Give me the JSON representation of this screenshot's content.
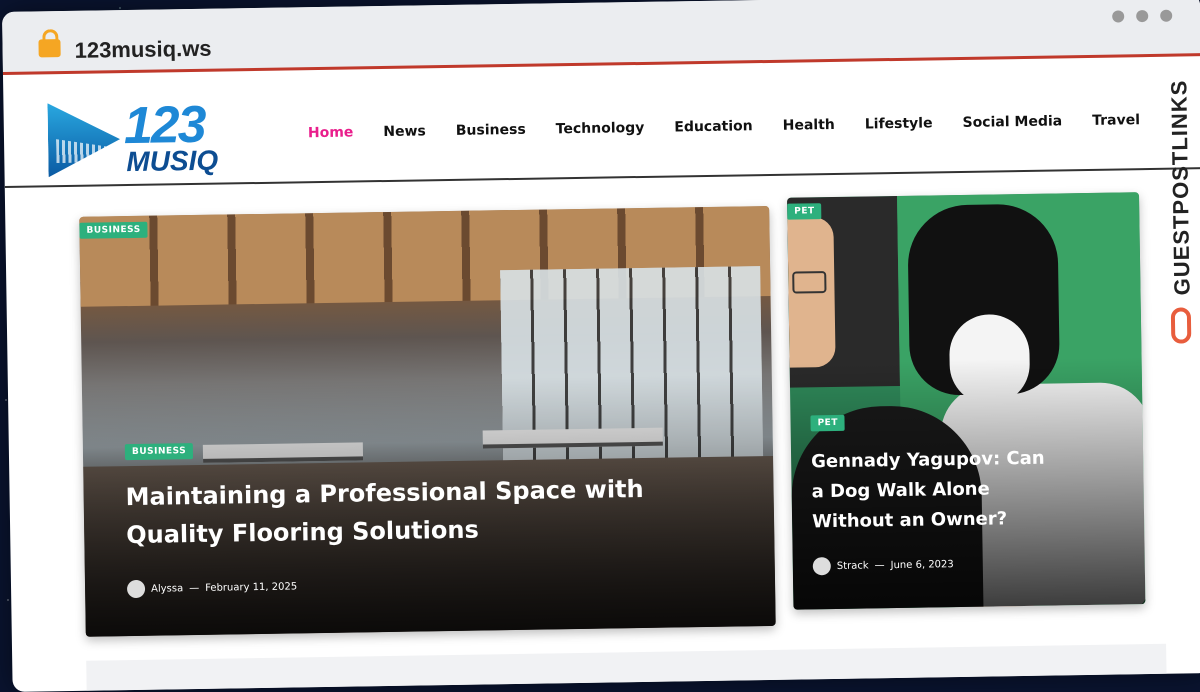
{
  "browser": {
    "url": "123musiq.ws"
  },
  "logo": {
    "number": "123",
    "word": "MUSIQ"
  },
  "nav": {
    "items": [
      "Home",
      "News",
      "Business",
      "Technology",
      "Education",
      "Health",
      "Lifestyle",
      "Social Media",
      "Travel"
    ],
    "active": "Home"
  },
  "side_brand": {
    "text": "GUESTPOSTLINKS"
  },
  "featured_main": {
    "corner_badge": "BUSINESS",
    "badge": "BUSINESS",
    "title": "Maintaining a Professional Space with Quality Flooring Solutions",
    "author": "Alyssa",
    "separator": "—",
    "date": "February 11, 2025"
  },
  "featured_side": {
    "corner_badge": "PET",
    "badge": "PET",
    "title": "Gennady Yagupov: Can a Dog Walk Alone Without an Owner?",
    "author": "Strack",
    "separator": "—",
    "date": "June 6, 2023"
  },
  "colors": {
    "accent": "#e91e8c",
    "badge": "#2db07d",
    "brand_blue": "#1e88d6",
    "bar_red": "#c0392b"
  }
}
